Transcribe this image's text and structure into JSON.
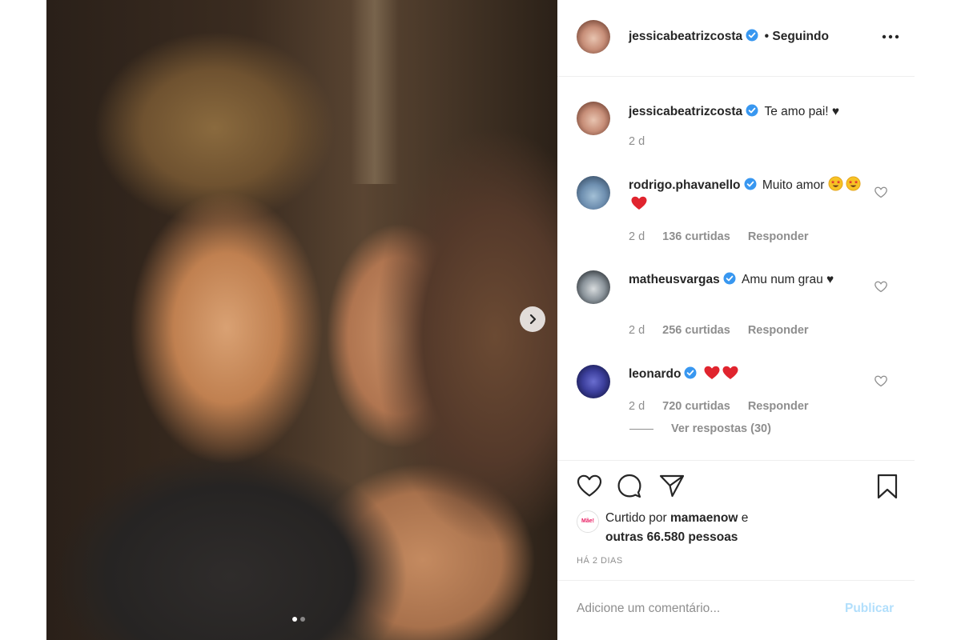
{
  "post": {
    "author": "jessicabeatrizcosta",
    "follow_label": "• Seguindo",
    "caption": "Te amo pai! ♥",
    "caption_time": "2 d",
    "carousel": {
      "slides": 2,
      "active_index": 0
    }
  },
  "comments": [
    {
      "user": "rodrigo.phavanello",
      "verified": true,
      "text": "Muito amor",
      "emojis": [
        "star-struck",
        "star-struck",
        "red-heart"
      ],
      "time": "2 d",
      "likes": "136 curtidas",
      "reply": "Responder"
    },
    {
      "user": "matheusvargas",
      "verified": true,
      "text": "Amu num grau ♥",
      "emojis": [],
      "time": "2 d",
      "likes": "256 curtidas",
      "reply": "Responder"
    },
    {
      "user": "leonardo",
      "verified": true,
      "text": "",
      "emojis": [
        "red-heart",
        "red-heart"
      ],
      "time": "2 d",
      "likes": "720 curtidas",
      "reply": "Responder",
      "view_replies": "Ver respostas (30)"
    }
  ],
  "footer": {
    "liked_by_prefix": "Curtido por ",
    "liked_by_user": "mamaenow",
    "liked_by_mid": " e",
    "liked_by_others": "outras 66.580 pessoas",
    "liker_avatar_text": "Mãe!",
    "timestamp": "HÁ 2 DIAS",
    "comment_placeholder": "Adicione um comentário...",
    "publish_label": "Publicar"
  },
  "colors": {
    "verified": "#3897f0",
    "heart": "#ed4956",
    "publish_disabled": "#b2dffc",
    "meta": "#8e8e8e"
  }
}
